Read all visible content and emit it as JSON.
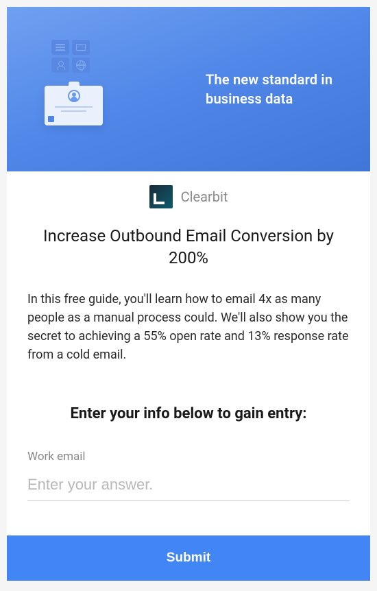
{
  "hero": {
    "tagline": "The new standard in business data"
  },
  "brand": {
    "name": "Clearbit"
  },
  "content": {
    "headline": "Increase Outbound Email Conversion by 200%",
    "description": "In this free guide, you'll learn how to email 4x as many people as a manual process could. We'll also show you the secret to achieving a 55% open rate and 13% response rate from a cold email."
  },
  "form": {
    "title": "Enter your info below to gain entry:",
    "email_label": "Work email",
    "email_placeholder": "Enter your answer.",
    "submit_label": "Submit"
  }
}
